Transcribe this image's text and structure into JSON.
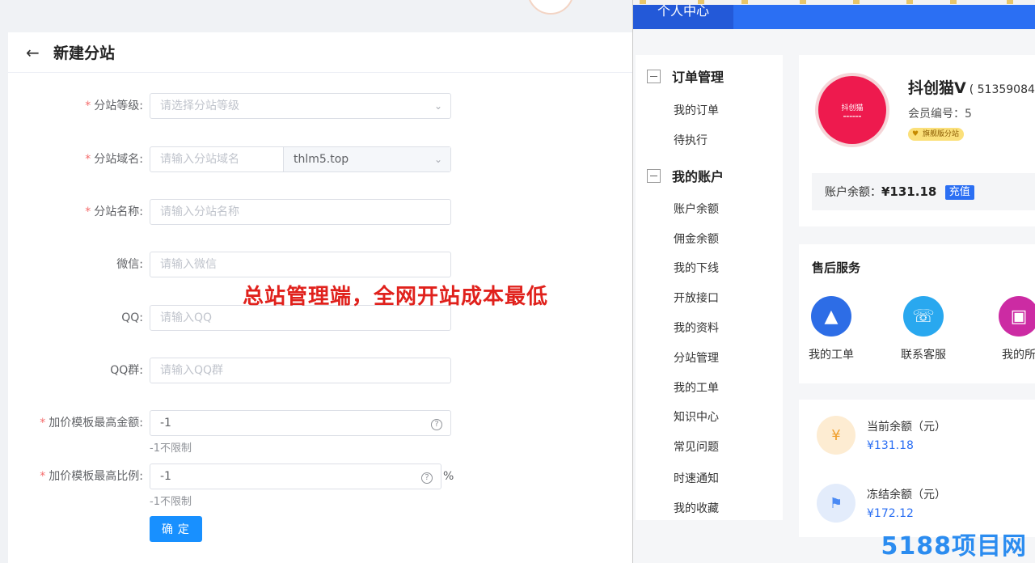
{
  "left": {
    "title": "新建分站",
    "fields": {
      "level": {
        "label": "分站等级:",
        "placeholder": "请选择分站等级"
      },
      "domain": {
        "label": "分站域名:",
        "placeholder": "请输入分站域名",
        "suffix_value": "thlm5.top"
      },
      "name": {
        "label": "分站名称:",
        "placeholder": "请输入分站名称"
      },
      "wechat": {
        "label": "微信:",
        "placeholder": "请输入微信"
      },
      "qq": {
        "label": "QQ:",
        "placeholder": "请输入QQ"
      },
      "qqgroup": {
        "label": "QQ群:",
        "placeholder": "请输入QQ群"
      },
      "max_amount": {
        "label": "加价模板最高金额:",
        "value": "-1",
        "hint": "-1不限制"
      },
      "max_ratio": {
        "label": "加价模板最高比例:",
        "value": "-1",
        "hint": "-1不限制",
        "unit": "%"
      }
    },
    "submit_label": "确 定",
    "overlay": "总站管理端，全网开站成本最低"
  },
  "right": {
    "top_tab": "个人中心",
    "menu": {
      "groups": [
        {
          "label": "订单管理",
          "items": [
            "我的订单",
            "待执行"
          ]
        },
        {
          "label": "我的账户",
          "items": [
            "账户余额",
            "佣金余额",
            "我的下线",
            "开放接口",
            "我的资料",
            "分站管理",
            "我的工单",
            "知识中心",
            "常见问题",
            "时速通知",
            "我的收藏"
          ]
        }
      ]
    },
    "profile": {
      "avatar_text": "抖创猫",
      "name": "抖创猫V",
      "uid": "( 51359084",
      "member_no": "会员编号：5",
      "badge": "旗舰版分站",
      "balance_label": "账户余额：",
      "balance_value": "¥131.18",
      "recharge": "充值"
    },
    "service": {
      "title": "售后服务",
      "items": [
        {
          "label": "我的工单",
          "icon": "ticket-icon",
          "color": "#2d6de6"
        },
        {
          "label": "联系客服",
          "icon": "headset-icon",
          "color": "#29a8ef"
        },
        {
          "label": "我的所",
          "icon": "monitor-icon",
          "color": "#cc2ba3"
        }
      ]
    },
    "wallet": [
      {
        "label": "当前余额（元）",
        "amount": "¥131.18",
        "icon": "money-bag-icon"
      },
      {
        "label": "冻结余额（元）",
        "amount": "¥172.12",
        "icon": "lock-icon"
      }
    ],
    "watermark": "5188项目网"
  }
}
